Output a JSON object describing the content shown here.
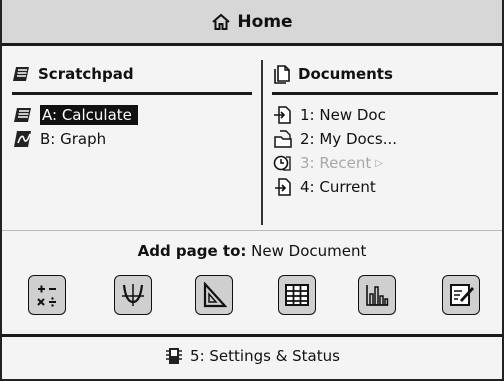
{
  "title": "Home",
  "scratchpad": {
    "heading": "Scratchpad",
    "items": [
      {
        "label": "A: Calculate",
        "icon": "calculator-icon",
        "selected": true
      },
      {
        "label": "B: Graph",
        "icon": "graph-icon",
        "selected": false
      }
    ]
  },
  "documents": {
    "heading": "Documents",
    "items": [
      {
        "label": "1: New Doc",
        "icon": "new-doc-icon",
        "enabled": true
      },
      {
        "label": "2: My Docs...",
        "icon": "folder-icon",
        "enabled": true
      },
      {
        "label": "3: Recent",
        "icon": "recent-icon",
        "enabled": false
      },
      {
        "label": "4: Current",
        "icon": "current-doc-icon",
        "enabled": true
      }
    ]
  },
  "add_page": {
    "label": "Add page to:",
    "target": "New Document",
    "tools": [
      "calculator-app-icon",
      "graphs-app-icon",
      "geometry-app-icon",
      "lists-spreadsheet-app-icon",
      "data-statistics-app-icon",
      "notes-app-icon"
    ]
  },
  "settings": {
    "label": "5: Settings & Status",
    "icon": "settings-icon"
  }
}
